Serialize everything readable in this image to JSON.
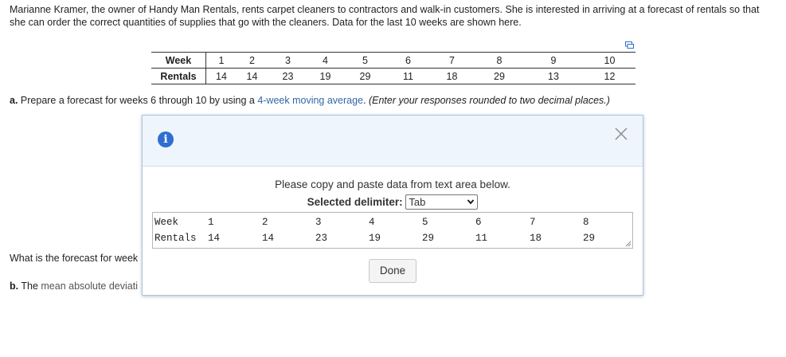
{
  "problem": {
    "text": "Marianne Kramer, the owner of Handy Man Rentals, rents carpet cleaners to contractors and walk-in customers. She is interested in arriving at a forecast of rentals so that she can order the correct quantities of supplies that go with the cleaners. Data for the last 10 weeks are shown here."
  },
  "data_table": {
    "rows": [
      {
        "label": "Week",
        "values": [
          "1",
          "2",
          "3",
          "4",
          "5",
          "6",
          "7",
          "8",
          "9",
          "10"
        ]
      },
      {
        "label": "Rentals",
        "values": [
          "14",
          "14",
          "23",
          "19",
          "29",
          "11",
          "18",
          "29",
          "13",
          "12"
        ]
      }
    ]
  },
  "question_a": {
    "prefix": "a.",
    "text1": " Prepare a forecast for weeks 6 through 10 by using a ",
    "link": "4-week moving average",
    "text2": ". ",
    "note": "(Enter your responses rounded to two decimal places.)"
  },
  "forecast_question": "What is the forecast for week",
  "question_b": {
    "prefix": "b.",
    "text1": " The ",
    "link": "mean absolute deviati"
  },
  "modal": {
    "instructions": "Please copy and paste data from text area below.",
    "delimiter_label": "Selected delimiter:",
    "delimiter_value": "Tab",
    "textarea": {
      "row1": [
        "Week",
        "1",
        "2",
        "3",
        "4",
        "5",
        "6",
        "7",
        "8"
      ],
      "row2": [
        "Rentals",
        "14",
        "14",
        "23",
        "19",
        "29",
        "11",
        "18",
        "29"
      ]
    },
    "done_label": "Done"
  },
  "colors": {
    "link_blue": "#3366a8",
    "info_blue": "#2e6fd0",
    "modal_header_bg": "#eef5fc",
    "modal_border": "#a9c6e4"
  },
  "icons": {
    "info": "info-icon",
    "close": "close-icon",
    "copy": "copy-icon",
    "dropdown": "chevron-down-icon"
  }
}
